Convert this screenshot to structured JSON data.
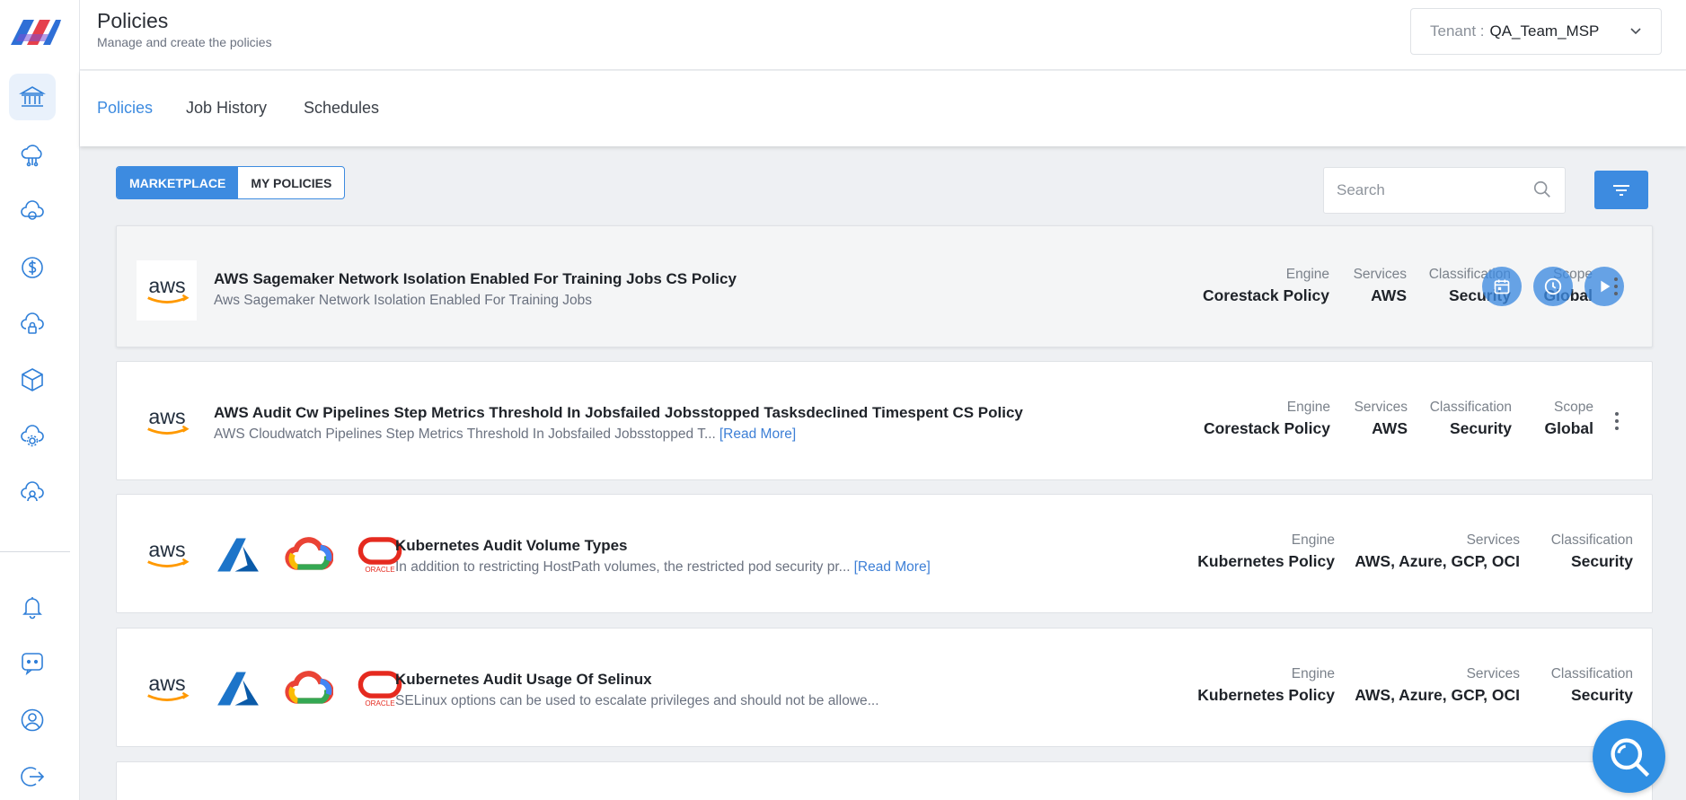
{
  "header": {
    "title": "Policies",
    "subtitle": "Manage and create the policies",
    "tenant_label": "Tenant :",
    "tenant_value": "QA_Team_MSP"
  },
  "tabs": [
    {
      "label": "Policies",
      "active": true
    },
    {
      "label": "Job History",
      "active": false
    },
    {
      "label": "Schedules",
      "active": false
    }
  ],
  "toolbar": {
    "marketplace_label": "MARKETPLACE",
    "my_policies_label": "MY POLICIES",
    "search_placeholder": "Search"
  },
  "sidebar": {
    "icons": [
      "bank-icon",
      "cloud-network-icon",
      "cloud-sync-icon",
      "dollar-icon",
      "cloud-lock-icon",
      "cube-icon",
      "cloud-gear-icon",
      "cloud-user-icon",
      "bell-icon",
      "chat-icon",
      "user-icon",
      "logout-icon"
    ]
  },
  "policies": [
    {
      "title": "AWS Sagemaker Network Isolation Enabled For Training Jobs CS Policy",
      "description": "Aws Sagemaker Network Isolation Enabled For Training Jobs",
      "read_more": "",
      "meta": [
        {
          "key": "Engine",
          "value": "Corestack Policy"
        },
        {
          "key": "Services",
          "value": "AWS"
        },
        {
          "key": "Classification",
          "value": "Security"
        },
        {
          "key": "Scope",
          "value": "Global"
        }
      ]
    },
    {
      "title": "AWS Audit Cw Pipelines Step Metrics Threshold In Jobsfailed Jobsstopped Tasksdeclined Timespent CS Policy",
      "description": "AWS Cloudwatch Pipelines Step Metrics Threshold In Jobsfailed Jobsstopped T...",
      "read_more": "[Read More]",
      "meta": [
        {
          "key": "Engine",
          "value": "Corestack Policy"
        },
        {
          "key": "Services",
          "value": "AWS"
        },
        {
          "key": "Classification",
          "value": "Security"
        },
        {
          "key": "Scope",
          "value": "Global"
        }
      ]
    },
    {
      "title": "Kubernetes Audit Volume Types",
      "description": "In addition to restricting HostPath volumes, the restricted pod security pr...",
      "read_more": "[Read More]",
      "meta": [
        {
          "key": "Engine",
          "value": "Kubernetes Policy"
        },
        {
          "key": "Services",
          "value": "AWS, Azure, GCP, OCI"
        },
        {
          "key": "Classification",
          "value": "Security"
        }
      ]
    },
    {
      "title": "Kubernetes Audit Usage Of Selinux",
      "description": "SELinux options can be used to escalate privileges and should not be allowe...",
      "read_more": "",
      "meta": [
        {
          "key": "Engine",
          "value": "Kubernetes Policy"
        },
        {
          "key": "Services",
          "value": "AWS, Azure, GCP, OCI"
        },
        {
          "key": "Classification",
          "value": "Security"
        }
      ]
    }
  ],
  "logos": {
    "aws_text": "aws",
    "oracle_text": "ORACLE"
  },
  "colors": {
    "accent": "#3d8be0",
    "aws_orange": "#ff9900",
    "azure_blue": "#0a6fc2",
    "oracle_red": "#e52a1f"
  }
}
